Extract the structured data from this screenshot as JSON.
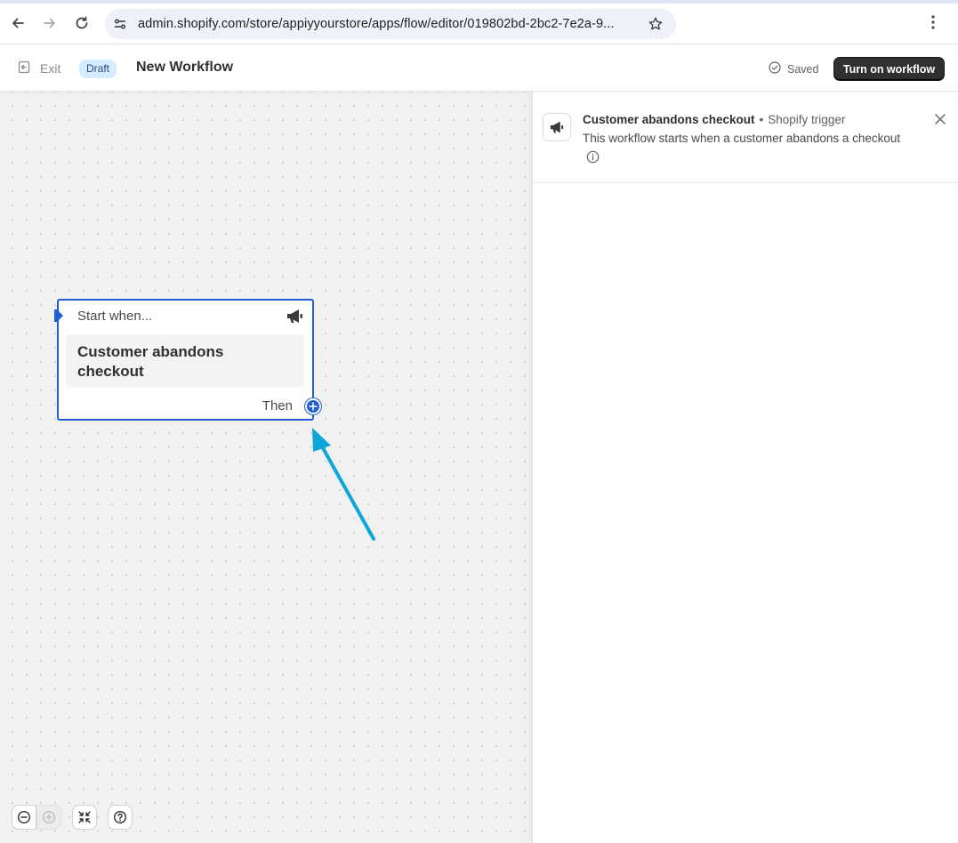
{
  "browser": {
    "url": "admin.shopify.com/store/appiyyourstore/apps/flow/editor/019802bd-2bc2-7e2a-9...",
    "icons": [
      "back-icon",
      "forward-icon",
      "reload-icon",
      "site-settings-icon",
      "bookmark-star-icon",
      "kebab-menu-icon"
    ]
  },
  "header": {
    "exit_label": "Exit",
    "status_badge": "Draft",
    "title": "New Workflow",
    "saved_label": "Saved",
    "primary_button": "Turn on workflow"
  },
  "canvas": {
    "trigger_card": {
      "start_label": "Start when...",
      "title": "Customer abandons checkout",
      "then_label": "Then",
      "icon": "megaphone-icon"
    },
    "toolbar": {
      "icons": [
        "zoom-out-icon",
        "zoom-in-icon",
        "fit-view-icon",
        "help-icon"
      ]
    },
    "annotation": {
      "color": "#0ea5d9"
    }
  },
  "panel": {
    "title": "Customer abandons checkout",
    "subtitle": "Shopify trigger",
    "description": "This workflow starts when a customer abandons a checkout",
    "icons": [
      "megaphone-icon",
      "info-icon",
      "close-icon"
    ]
  },
  "colors": {
    "accent": "#1f5ed4",
    "primary_button_bg": "#303030",
    "badge_bg": "#d5ebff"
  }
}
